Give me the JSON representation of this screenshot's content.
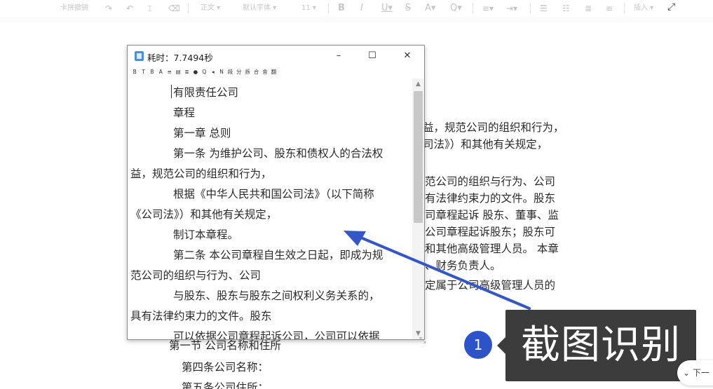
{
  "toolbar": {
    "clear_format_label": "卡拼撤销",
    "paragraph_label": "正文",
    "font_label": "默认字体",
    "size_label": "11",
    "insert_label": "插入",
    "fullscreen_icon": "fullscreen-icon"
  },
  "document": {
    "right_lines": [
      "益，规范公司的组织和行为，",
      "司法》）和其他有关规定，",
      "范公司的组织与行为、公司",
      "有法律约束力的文件。股东",
      "司章程起诉  股东、董事、监",
      "公司章程起诉股东；股东可",
      "和其他高级管理人员。  本章",
      "、财务负责人。",
      "定属于公司高级管理人员的"
    ],
    "bottom_lines": [
      "第一节  公司名称和住所",
      "第四条公司名称：",
      "第五条公司住所："
    ]
  },
  "popup": {
    "title": "耗时：7.7494秒",
    "minimize": "–",
    "maximize": "☐",
    "close": "✕",
    "tools": [
      "B",
      "T",
      "B",
      "A",
      "≡",
      "▤",
      "≣",
      "●",
      "Q",
      "◂",
      "N",
      "段",
      "分",
      "拆",
      "合",
      "舍",
      "翻"
    ],
    "ocr_lines": [
      "有限责任公司",
      "章程",
      "第一章 总则",
      "第一条   为维护公司、股东和债权人的合法权",
      "益，规范公司的组织和行为，",
      "根据《中华人民共和国公司法》（以下简称",
      "《公司法》）和其他有关规定，",
      "制订本章程。",
      "第二条   本公司章程自生效之日起，即成为规",
      "范公司的组织与行为、公司",
      "与股东、股东与股东之间权利义务关系的，",
      "具有法律约束力的文件。股东",
      "可以依据公司章程起诉公司，公司可以依据"
    ]
  },
  "annotation": {
    "step_number": "1",
    "callout_text": "截图识别",
    "arrow_color": "#3456c8"
  },
  "next_button": {
    "label": "下一"
  }
}
